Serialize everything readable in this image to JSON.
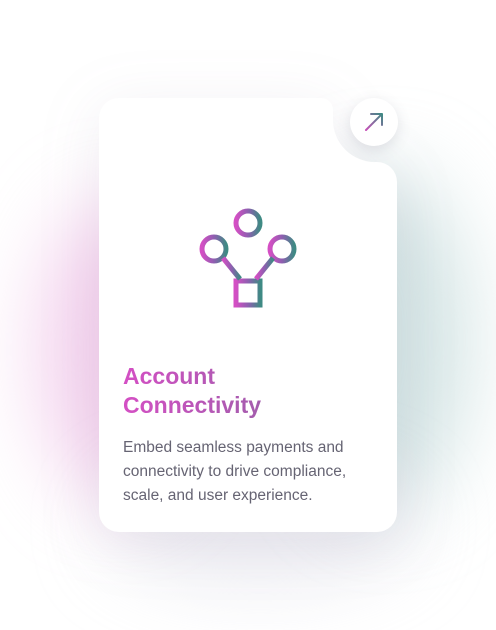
{
  "card": {
    "title": "Account\nConnectivity",
    "description": "Embed seamless payments and connectivity to drive compliance, scale, and user experience."
  },
  "icons": {
    "feature": "network-connectivity-icon",
    "action": "arrow-up-right-icon"
  },
  "colors": {
    "pink": "#d44fc4",
    "purple": "#8e5fb0",
    "slate": "#5d6f8c",
    "teal": "#3f8a84",
    "text": "#666473"
  }
}
